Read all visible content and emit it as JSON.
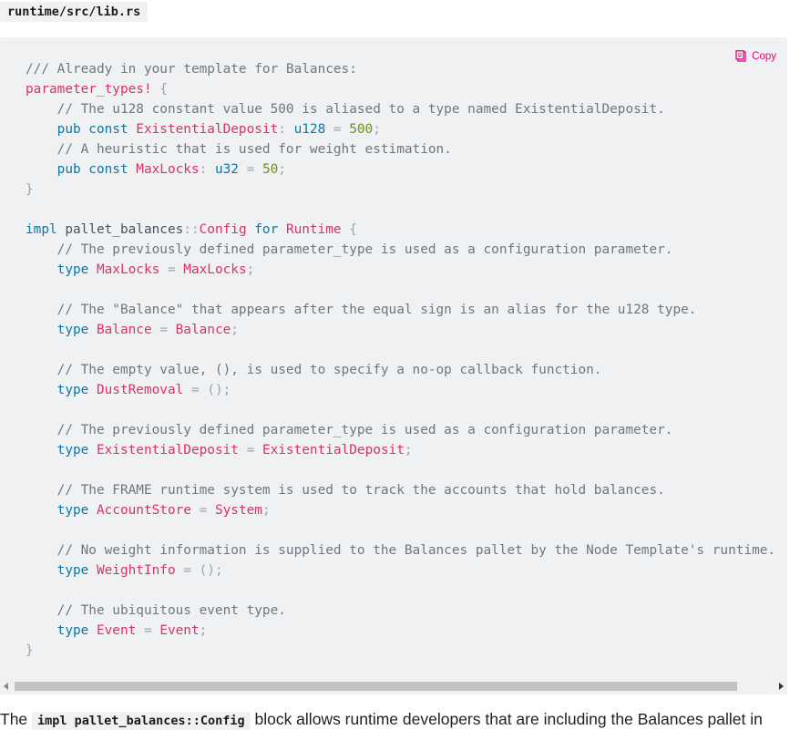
{
  "file_label": "runtime/src/lib.rs",
  "copy_label": "Copy",
  "code_lines": [
    [
      [
        "cmt",
        "/// Already in your template for Balances:"
      ]
    ],
    [
      [
        "mac",
        "parameter_types!"
      ],
      [
        "pun",
        " {"
      ]
    ],
    [
      [
        "sp",
        "    "
      ],
      [
        "cmt",
        "// The u128 constant value 500 is aliased to a type named ExistentialDeposit."
      ]
    ],
    [
      [
        "sp",
        "    "
      ],
      [
        "kw",
        "pub const "
      ],
      [
        "ty",
        "ExistentialDeposit"
      ],
      [
        "pun",
        ": "
      ],
      [
        "kw",
        "u128"
      ],
      [
        "pun",
        " = "
      ],
      [
        "num",
        "500"
      ],
      [
        "pun",
        ";"
      ]
    ],
    [
      [
        "sp",
        "    "
      ],
      [
        "cmt",
        "// A heuristic that is used for weight estimation."
      ]
    ],
    [
      [
        "sp",
        "    "
      ],
      [
        "kw",
        "pub const "
      ],
      [
        "ty",
        "MaxLocks"
      ],
      [
        "pun",
        ": "
      ],
      [
        "kw",
        "u32"
      ],
      [
        "pun",
        " = "
      ],
      [
        "num",
        "50"
      ],
      [
        "pun",
        ";"
      ]
    ],
    [
      [
        "pun",
        "}"
      ]
    ],
    [],
    [
      [
        "kw",
        "impl "
      ],
      [
        "id",
        "pallet_balances"
      ],
      [
        "pun",
        "::"
      ],
      [
        "ty",
        "Config"
      ],
      [
        "kw",
        " for "
      ],
      [
        "ty",
        "Runtime"
      ],
      [
        "pun",
        " {"
      ]
    ],
    [
      [
        "sp",
        "    "
      ],
      [
        "cmt",
        "// The previously defined parameter_type is used as a configuration parameter."
      ]
    ],
    [
      [
        "sp",
        "    "
      ],
      [
        "kw",
        "type "
      ],
      [
        "ty",
        "MaxLocks"
      ],
      [
        "pun",
        " = "
      ],
      [
        "ty",
        "MaxLocks"
      ],
      [
        "pun",
        ";"
      ]
    ],
    [],
    [
      [
        "sp",
        "    "
      ],
      [
        "cmt",
        "// The \"Balance\" that appears after the equal sign is an alias for the u128 type."
      ]
    ],
    [
      [
        "sp",
        "    "
      ],
      [
        "kw",
        "type "
      ],
      [
        "ty",
        "Balance"
      ],
      [
        "pun",
        " = "
      ],
      [
        "ty",
        "Balance"
      ],
      [
        "pun",
        ";"
      ]
    ],
    [],
    [
      [
        "sp",
        "    "
      ],
      [
        "cmt",
        "// The empty value, (), is used to specify a no-op callback function."
      ]
    ],
    [
      [
        "sp",
        "    "
      ],
      [
        "kw",
        "type "
      ],
      [
        "ty",
        "DustRemoval"
      ],
      [
        "pun",
        " = ();"
      ]
    ],
    [],
    [
      [
        "sp",
        "    "
      ],
      [
        "cmt",
        "// The previously defined parameter_type is used as a configuration parameter."
      ]
    ],
    [
      [
        "sp",
        "    "
      ],
      [
        "kw",
        "type "
      ],
      [
        "ty",
        "ExistentialDeposit"
      ],
      [
        "pun",
        " = "
      ],
      [
        "ty",
        "ExistentialDeposit"
      ],
      [
        "pun",
        ";"
      ]
    ],
    [],
    [
      [
        "sp",
        "    "
      ],
      [
        "cmt",
        "// The FRAME runtime system is used to track the accounts that hold balances."
      ]
    ],
    [
      [
        "sp",
        "    "
      ],
      [
        "kw",
        "type "
      ],
      [
        "ty",
        "AccountStore"
      ],
      [
        "pun",
        " = "
      ],
      [
        "ty",
        "System"
      ],
      [
        "pun",
        ";"
      ]
    ],
    [],
    [
      [
        "sp",
        "    "
      ],
      [
        "cmt",
        "// No weight information is supplied to the Balances pallet by the Node Template's runtime."
      ]
    ],
    [
      [
        "sp",
        "    "
      ],
      [
        "kw",
        "type "
      ],
      [
        "ty",
        "WeightInfo"
      ],
      [
        "pun",
        " = ();"
      ]
    ],
    [],
    [
      [
        "sp",
        "    "
      ],
      [
        "cmt",
        "// The ubiquitous event type."
      ]
    ],
    [
      [
        "sp",
        "    "
      ],
      [
        "kw",
        "type "
      ],
      [
        "ty",
        "Event"
      ],
      [
        "pun",
        " = "
      ],
      [
        "ty",
        "Event"
      ],
      [
        "pun",
        ";"
      ]
    ],
    [
      [
        "pun",
        "}"
      ]
    ]
  ],
  "paragraph": {
    "before": "The ",
    "code": "impl pallet_balances::Config",
    "after": " block allows runtime developers that are including the Balances pallet in"
  },
  "colors": {
    "accent": "#e6007a",
    "code_bg": "#f0f1f2",
    "keyword": "#0a77a8",
    "type": "#d6336c",
    "number": "#6a8f1d",
    "comment": "#6e7781"
  },
  "icons": {
    "copy": "clipboard-icon"
  }
}
